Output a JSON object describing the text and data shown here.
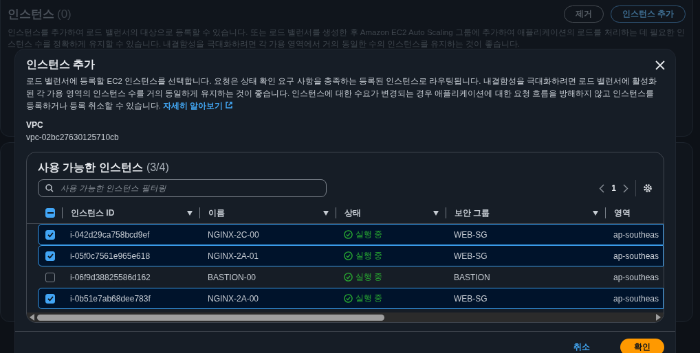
{
  "background": {
    "title": "인스턴스",
    "count": "(0)",
    "buttons": [
      {
        "label": "제거",
        "kind": "normal"
      },
      {
        "label": "인스턴스 추가",
        "kind": "primary"
      }
    ],
    "description": "인스턴스를 추가하여 로드 밸런서의 대상으로 등록할 수 있습니다. 또는 로드 밸런서를 생성한 후 Amazon EC2 Auto Scaling 그룹에 추가하여 애플리케이션의 로드를 처리하는 데 필요한 인스턴스 수를 정확하게 유지할 수 있습니다. 내결함성을 극대화하려면 각 가용 영역에서 거의 동일한 수의 인스턴스를 유지하는 것이 좋습니다."
  },
  "modal": {
    "title": "인스턴스 추가",
    "description": "로드 밸런서에 등록할 EC2 인스턴스를 선택합니다. 요청은 상태 확인 요구 사항을 충족하는 등록된 인스턴스로 라우팅됩니다. 내결함성을 극대화하려면 로드 밸런서에 활성화된 각 가용 영역의 인스턴스 수를 거의 동일하게 유지하는 것이 좋습니다. 인스턴스에 대한 수요가 변경되는 경우 애플리케이션에 대한 요청 흐름을 방해하지 않고 인스턴스를 등록하거나 등록 취소할 수 있습니다.",
    "link": "자세히 알아보기",
    "vpc_label": "VPC",
    "vpc_value": "vpc-02bc27630125710cb",
    "table": {
      "title": "사용 가능한 인스턴스",
      "count": "(3/4)",
      "filter_placeholder": "사용 가능한 인스턴스 필터링",
      "page": "1",
      "select_all": {
        "checked": true,
        "indeterminate": true
      },
      "columns": [
        "인스턴스 ID",
        "이름",
        "상태",
        "보안 그룹",
        "영역"
      ],
      "rows": [
        {
          "selected": true,
          "id": "i-042d29ca758bcd9ef",
          "name": "NGINX-2C-00",
          "status": "실행 중",
          "security_group": "WEB-SG",
          "region": "ap-southeas"
        },
        {
          "selected": true,
          "id": "i-05f0c7561e965e618",
          "name": "NGINX-2A-01",
          "status": "실행 중",
          "security_group": "WEB-SG",
          "region": "ap-southeas"
        },
        {
          "selected": false,
          "id": "i-06f9d38825586d162",
          "name": "BASTION-00",
          "status": "실행 중",
          "security_group": "BASTION",
          "region": "ap-southeas"
        },
        {
          "selected": true,
          "id": "i-0b51e7ab68dee783f",
          "name": "NGINX-2A-00",
          "status": "실행 중",
          "security_group": "WEB-SG",
          "region": "ap-southeas"
        }
      ]
    },
    "buttons": [
      {
        "label": "취소",
        "kind": "link"
      },
      {
        "label": "확인",
        "kind": "primary"
      }
    ]
  }
}
